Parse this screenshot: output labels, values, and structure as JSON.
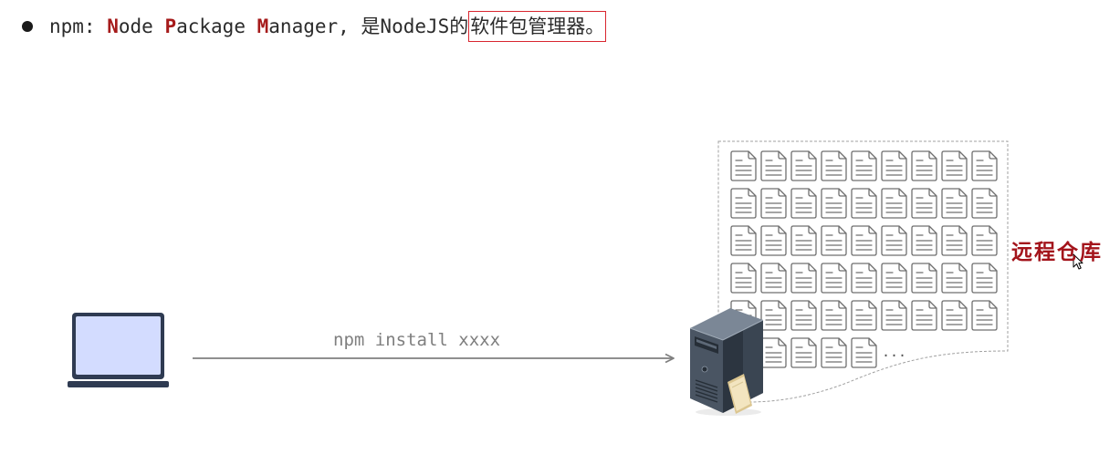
{
  "heading": {
    "bullet_icon": "bullet-dot-icon",
    "prefix": "npm: ",
    "acronym": [
      {
        "initial": "N",
        "rest": "ode "
      },
      {
        "initial": "P",
        "rest": "ackage "
      },
      {
        "initial": "M",
        "rest": "anager"
      }
    ],
    "suffix": ", 是NodeJS的",
    "highlighted": "软件包管理器。"
  },
  "diagram": {
    "client": {
      "icon": "laptop-icon"
    },
    "command": {
      "label": "npm install xxxx",
      "icon": "arrow-right-icon"
    },
    "registry": {
      "server_icon": "server-icon",
      "package_icon": "document-icon",
      "more": "...",
      "label": "远程仓库"
    },
    "cursor_icon": "mouse-pointer-icon"
  },
  "colors": {
    "accent": "#a61b1b",
    "highlight": "#d9262f",
    "label": "#a3141b",
    "arrow": "#7f7f7f",
    "laptop_frame": "#2f3b52",
    "laptop_screen": "#d3dcff",
    "document_stroke": "#6f6f6f",
    "boundary": "#a0a0a0",
    "text": "#2b2b2b"
  }
}
